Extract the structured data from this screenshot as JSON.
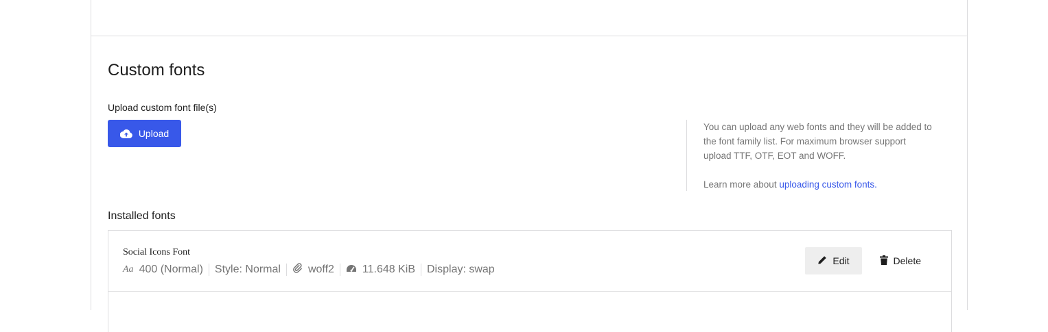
{
  "colors": {
    "accent": "#3858e9",
    "link": "#3858e9"
  },
  "section": {
    "title": "Custom fonts"
  },
  "upload": {
    "label": "Upload custom font file(s)",
    "button_label": "Upload",
    "icon": "cloud-upload-icon"
  },
  "help": {
    "text": "You can upload any web fonts and they will be added to the font family list. For maximum browser support upload TTF, OTF, EOT and WOFF.",
    "learn_prefix": "Learn more about ",
    "learn_link": "uploading custom fonts."
  },
  "installed": {
    "label": "Installed fonts",
    "fonts": [
      {
        "name": "Social Icons Font",
        "weight_icon_text": "Aa",
        "weight": "400 (Normal)",
        "style": "Style: Normal",
        "format": "woff2",
        "size": "11.648 KiB",
        "display": "Display: swap",
        "edit_label": "Edit",
        "delete_label": "Delete"
      }
    ]
  }
}
